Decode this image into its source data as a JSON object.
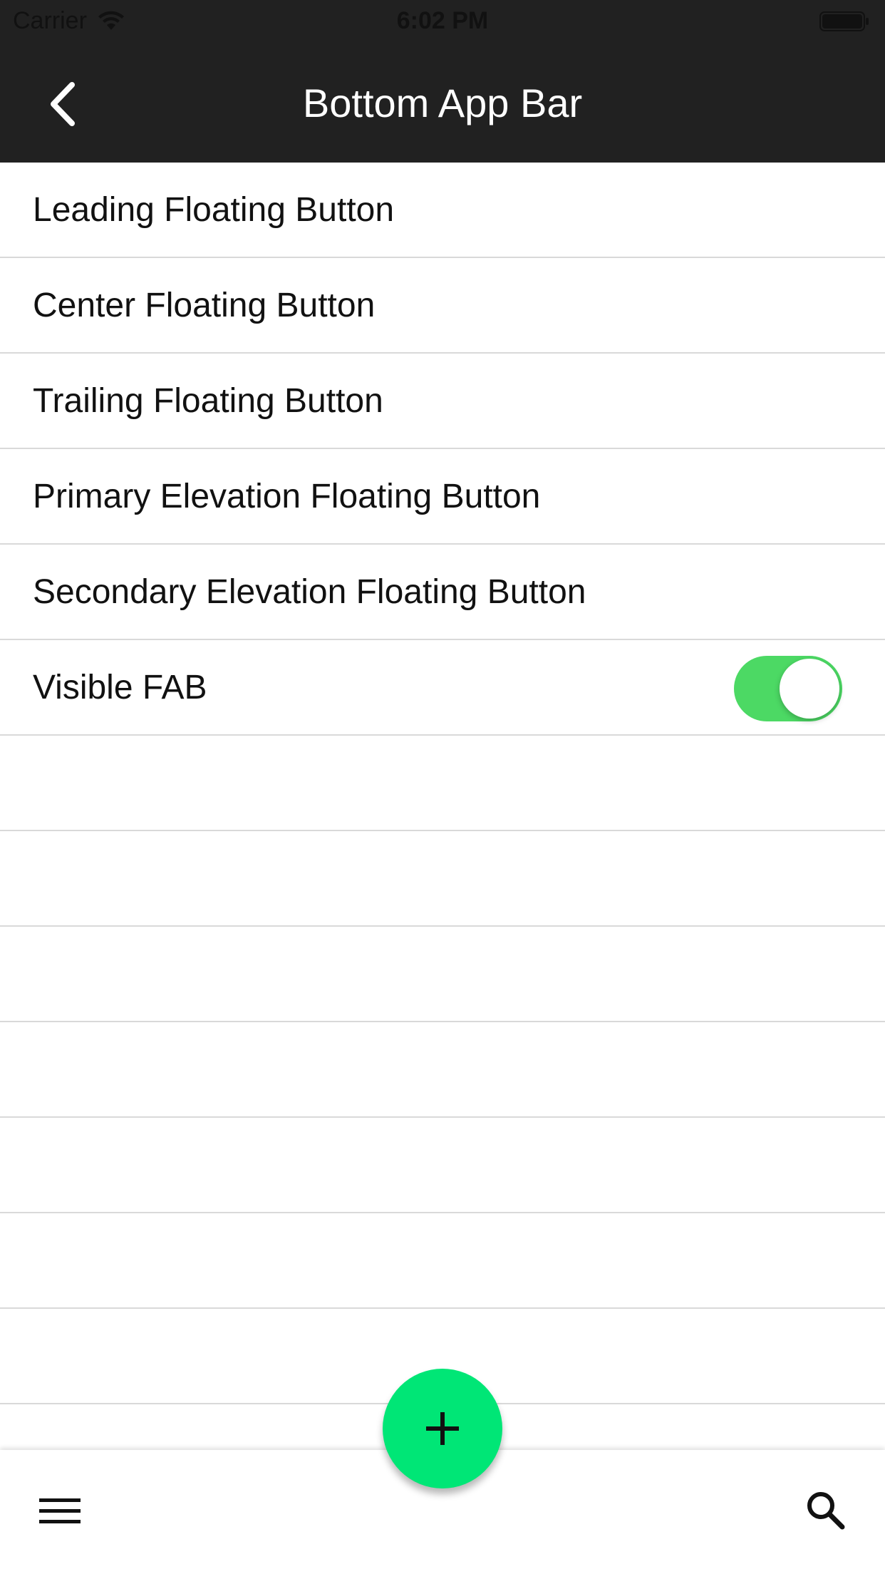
{
  "status_bar": {
    "carrier": "Carrier",
    "time": "6:02 PM",
    "wifi_icon": "wifi-icon",
    "battery_icon": "battery-icon"
  },
  "nav": {
    "title": "Bottom App Bar",
    "back_icon": "chevron-left-icon"
  },
  "list": {
    "items": [
      {
        "label": "Leading Floating Button"
      },
      {
        "label": "Center Floating Button"
      },
      {
        "label": "Trailing Floating Button"
      },
      {
        "label": "Primary Elevation Floating Button"
      },
      {
        "label": "Secondary Elevation Floating Button"
      },
      {
        "label": "Visible FAB",
        "toggle": true
      }
    ],
    "empty_rows": 7
  },
  "bottom_bar": {
    "menu_icon": "hamburger-menu-icon",
    "search_icon": "search-icon",
    "fab_icon": "plus-icon"
  },
  "colors": {
    "header_bg": "#212121",
    "fab": "#00e676",
    "toggle_on": "#4cd964",
    "divider": "#d9d9d9"
  }
}
